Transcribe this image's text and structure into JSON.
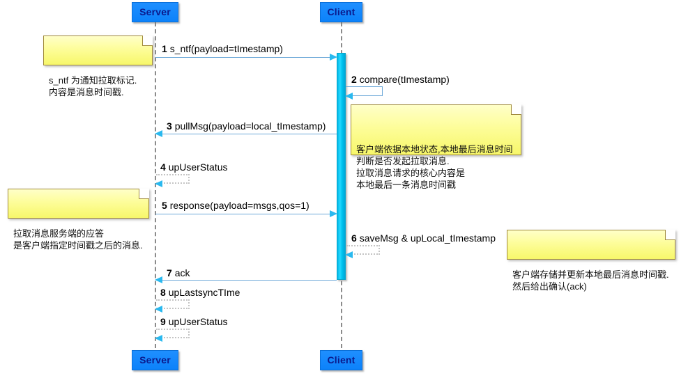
{
  "diagram": {
    "title": "Message pull sequence diagram",
    "background": "#ffffff",
    "colors": {
      "actor_fill": "#0c82fa",
      "actor_text": "#0b1a8c",
      "activation_fill": "#00c4ee",
      "note_fill": "#fdfd9a",
      "note_border": "#a08a3c",
      "message_line": "#6ca8d8",
      "arrow_head": "#2ab9ef",
      "lifeline": "#8b8b8b"
    }
  },
  "participants": [
    {
      "id": "server",
      "label": "Server"
    },
    {
      "id": "client",
      "label": "Client"
    }
  ],
  "participants_footer": [
    {
      "id": "server",
      "label": "Server"
    },
    {
      "id": "client",
      "label": "Client"
    }
  ],
  "messages": [
    {
      "seq": "1",
      "text": "s_ntf(payload=tImestamp)",
      "from": "server",
      "to": "client",
      "style": "solid",
      "kind": "call"
    },
    {
      "seq": "2",
      "text": "compare(tImestamp)",
      "from": "client",
      "to": "client",
      "style": "solid",
      "kind": "self"
    },
    {
      "seq": "3",
      "text": "pullMsg(payload=local_tImestamp)",
      "from": "client",
      "to": "server",
      "style": "solid",
      "kind": "call"
    },
    {
      "seq": "4",
      "text": "upUserStatus",
      "from": "server",
      "to": "server",
      "style": "dotted",
      "kind": "self"
    },
    {
      "seq": "5",
      "text": "response(payload=msgs,qos=1)",
      "from": "server",
      "to": "client",
      "style": "solid",
      "kind": "call"
    },
    {
      "seq": "6",
      "text": "saveMsg & upLocal_tImestamp",
      "from": "client",
      "to": "client",
      "style": "dotted",
      "kind": "self"
    },
    {
      "seq": "7",
      "text": "ack",
      "from": "client",
      "to": "server",
      "style": "solid",
      "kind": "call"
    },
    {
      "seq": "8",
      "text": "upLastsyncTIme",
      "from": "server",
      "to": "server",
      "style": "dotted",
      "kind": "self"
    },
    {
      "seq": "9",
      "text": "upUserStatus",
      "from": "server",
      "to": "server",
      "style": "dotted",
      "kind": "self"
    }
  ],
  "notes": [
    {
      "id": "note-s-ntf",
      "lines": "s_ntf 为通知拉取标记.\n内容是消息时间戳."
    },
    {
      "id": "note-client-compare",
      "lines": "客户端依据本地状态,本地最后消息时间\n判断是否发起拉取消息.\n拉取消息请求的核心内容是\n本地最后一条消息时间戳"
    },
    {
      "id": "note-server-response",
      "lines": "拉取消息服务端的应答\n是客户端指定时间戳之后的消息."
    },
    {
      "id": "note-client-save",
      "lines": "客户端存储并更新本地最后消息时间戳.\n然后给出确认(ack)"
    }
  ]
}
